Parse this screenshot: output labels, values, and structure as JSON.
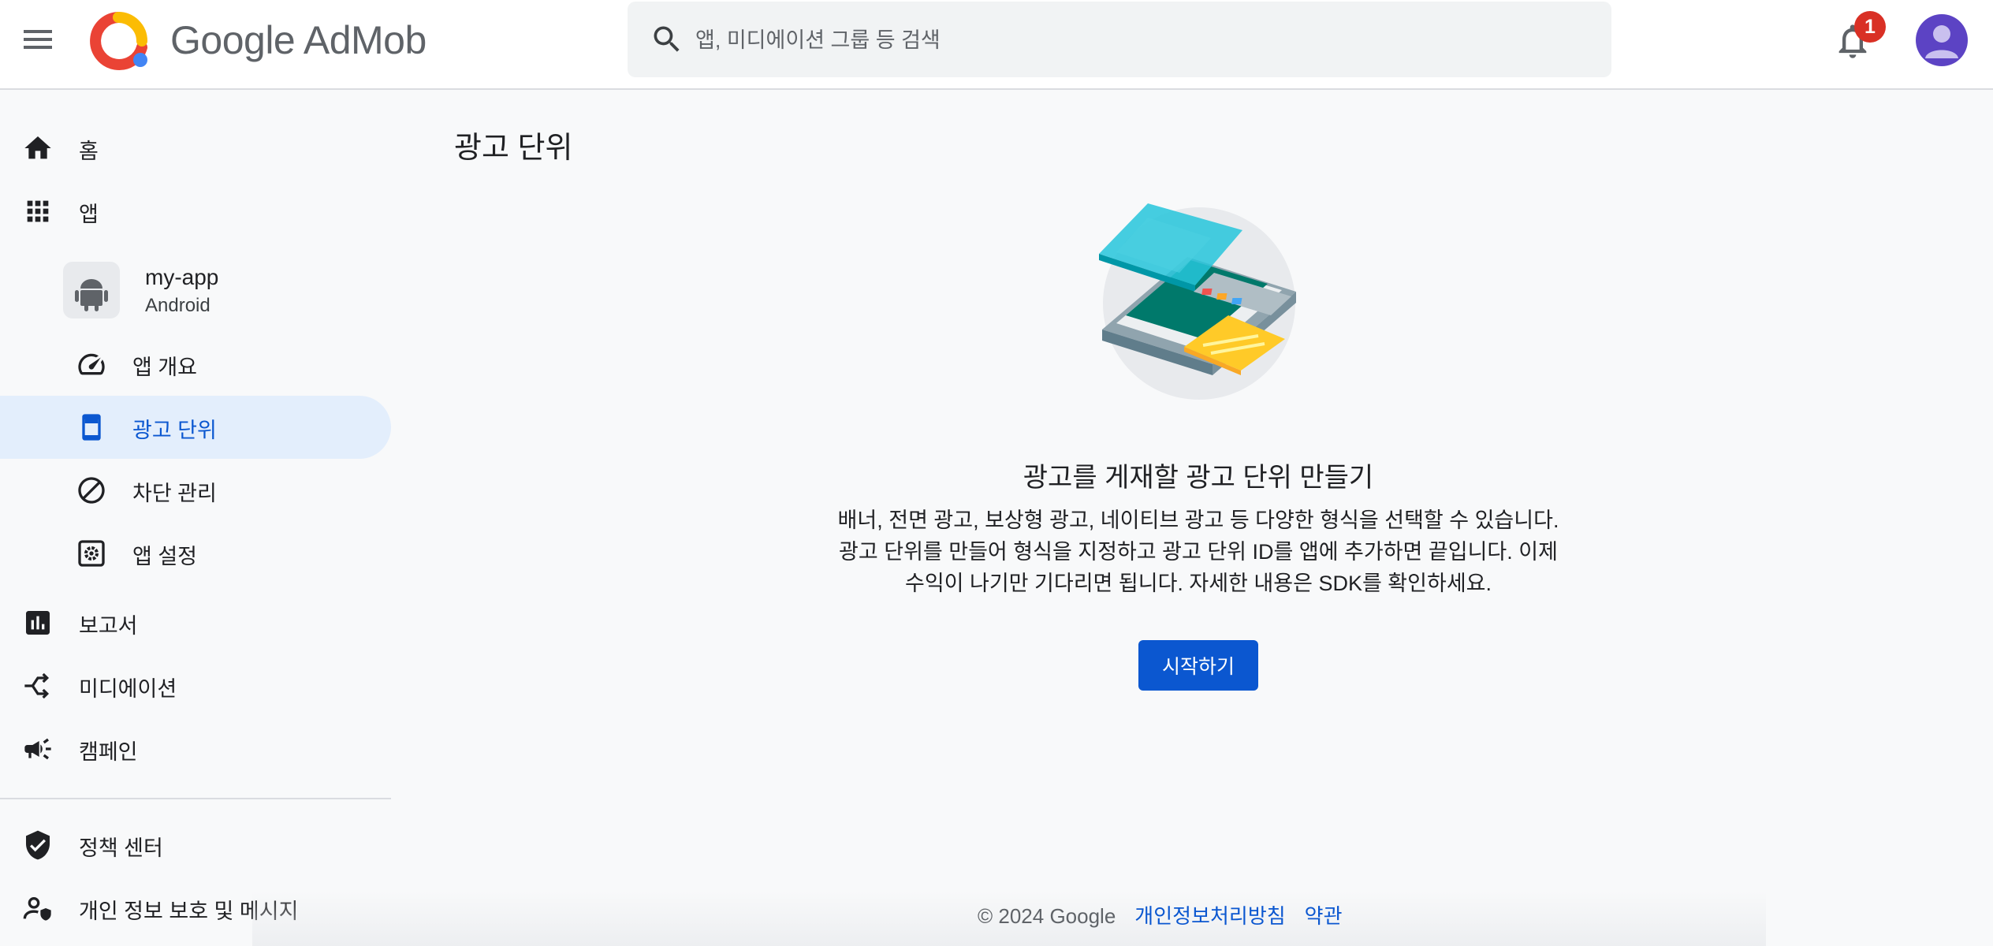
{
  "header": {
    "brand": "Google AdMob",
    "search_placeholder": "앱, 미디에이션 그룹 등 검색",
    "notification_count": "1",
    "colors": {
      "accent": "#0b57d0",
      "badge": "#d93025",
      "avatar": "#5c43c4"
    }
  },
  "sidebar": {
    "home": "홈",
    "apps": "앱",
    "app": {
      "name": "my-app",
      "platform": "Android"
    },
    "app_overview": "앱 개요",
    "ad_units": "광고 단위",
    "blocking": "차단 관리",
    "app_settings": "앱 설정",
    "reports": "보고서",
    "mediation": "미디에이션",
    "campaigns": "캠페인",
    "policy_center": "정책 센터",
    "privacy_messaging": "개인 정보 보호 및 메시지"
  },
  "main": {
    "title": "광고 단위",
    "empty_title": "광고를 게재할 광고 단위 만들기",
    "empty_desc_lines": [
      "배너, 전면 광고, 보상형 광고, 네이티브 광고 등 다양한 형식을 선택할 수 있습니다.",
      "광고 단위를 만들어 형식을 지정하고 광고 단위 ID를 앱에 추가하면 끝입니다. 이제",
      "수익이 나기만 기다리면 됩니다. 자세한 내용은 SDK를 확인하세요."
    ],
    "start_label": "시작하기"
  },
  "footer": {
    "copyright": "© 2024 Google",
    "privacy_link": "개인정보처리방침",
    "terms_link": "약관"
  }
}
